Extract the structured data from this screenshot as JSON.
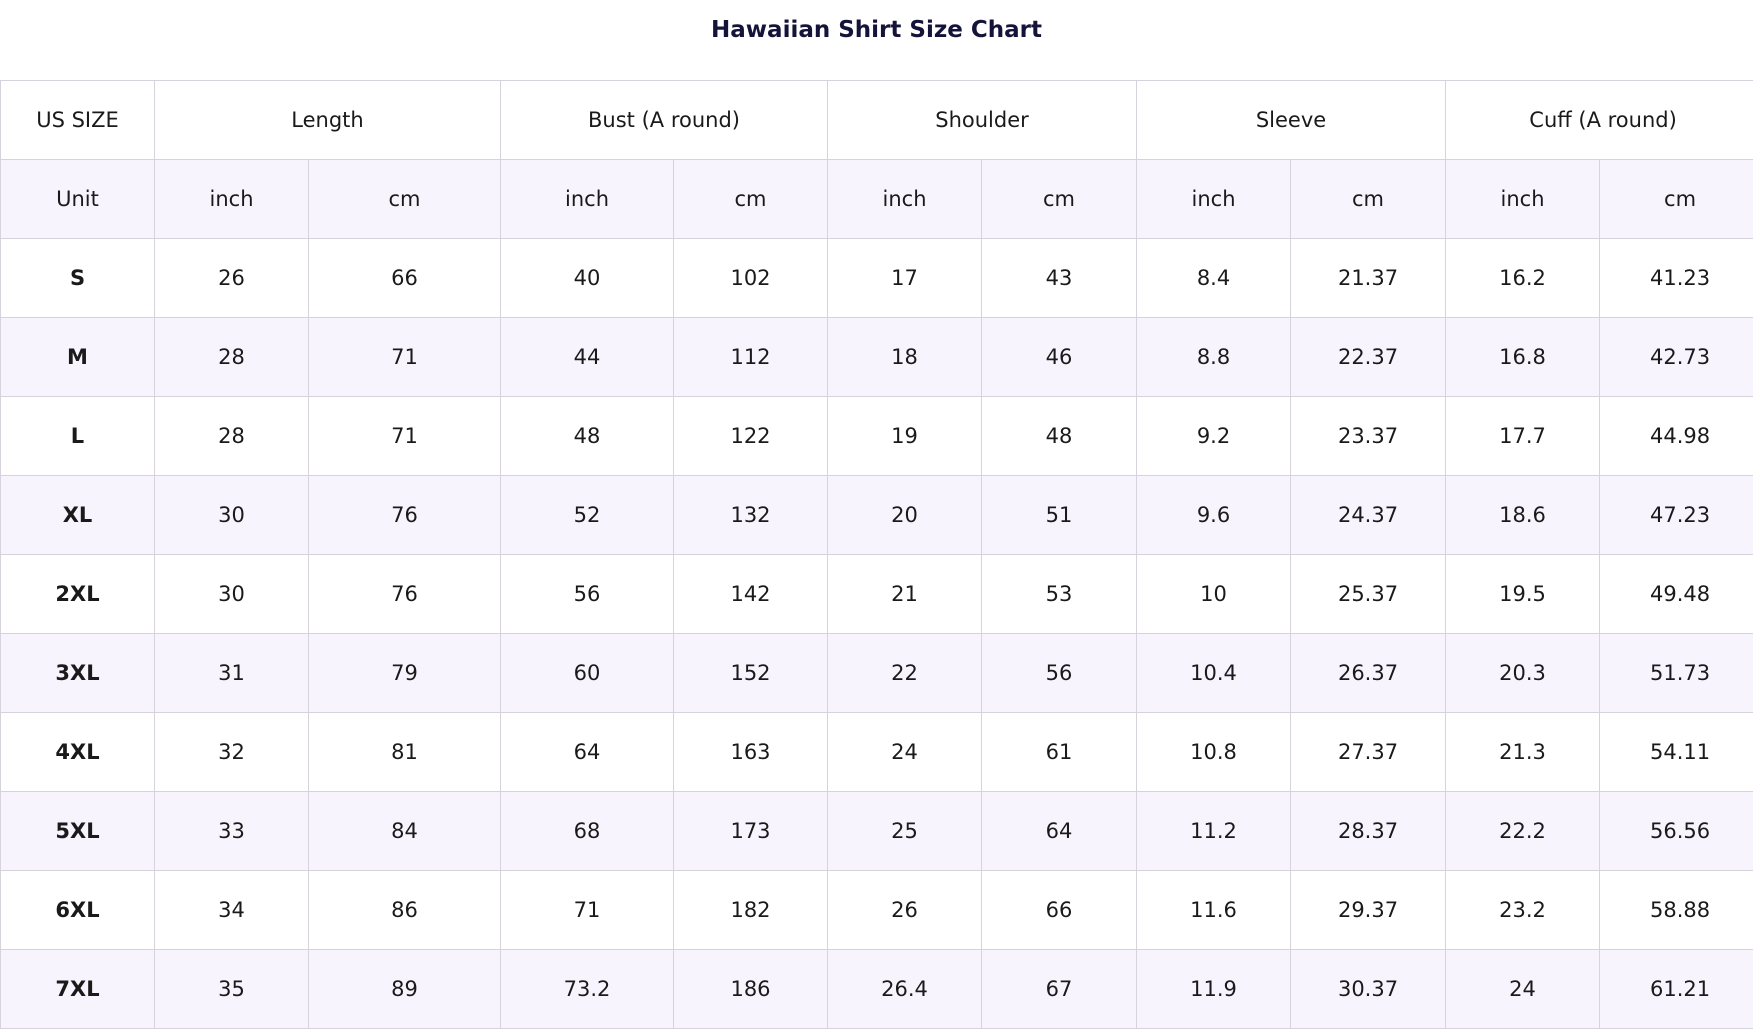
{
  "title": "Hawaiian Shirt Size Chart",
  "header": {
    "first": "US SIZE",
    "groups": [
      "Length",
      "Bust (A round)",
      "Shoulder",
      "Sleeve",
      "Cuff (A round)"
    ]
  },
  "unit_row": {
    "label": "Unit",
    "units": [
      "inch",
      "cm",
      "inch",
      "cm",
      "inch",
      "cm",
      "inch",
      "cm",
      "inch",
      "cm"
    ]
  },
  "rows": [
    {
      "size": "S",
      "values": [
        "26",
        "66",
        "40",
        "102",
        "17",
        "43",
        "8.4",
        "21.37",
        "16.2",
        "41.23"
      ]
    },
    {
      "size": "M",
      "values": [
        "28",
        "71",
        "44",
        "112",
        "18",
        "46",
        "8.8",
        "22.37",
        "16.8",
        "42.73"
      ]
    },
    {
      "size": "L",
      "values": [
        "28",
        "71",
        "48",
        "122",
        "19",
        "48",
        "9.2",
        "23.37",
        "17.7",
        "44.98"
      ]
    },
    {
      "size": "XL",
      "values": [
        "30",
        "76",
        "52",
        "132",
        "20",
        "51",
        "9.6",
        "24.37",
        "18.6",
        "47.23"
      ]
    },
    {
      "size": "2XL",
      "values": [
        "30",
        "76",
        "56",
        "142",
        "21",
        "53",
        "10",
        "25.37",
        "19.5",
        "49.48"
      ]
    },
    {
      "size": "3XL",
      "values": [
        "31",
        "79",
        "60",
        "152",
        "22",
        "56",
        "10.4",
        "26.37",
        "20.3",
        "51.73"
      ]
    },
    {
      "size": "4XL",
      "values": [
        "32",
        "81",
        "64",
        "163",
        "24",
        "61",
        "10.8",
        "27.37",
        "21.3",
        "54.11"
      ]
    },
    {
      "size": "5XL",
      "values": [
        "33",
        "84",
        "68",
        "173",
        "25",
        "64",
        "11.2",
        "28.37",
        "22.2",
        "56.56"
      ]
    },
    {
      "size": "6XL",
      "values": [
        "34",
        "86",
        "71",
        "182",
        "26",
        "66",
        "11.6",
        "29.37",
        "23.2",
        "58.88"
      ]
    },
    {
      "size": "7XL",
      "values": [
        "35",
        "89",
        "73.2",
        "186",
        "26.4",
        "67",
        "11.9",
        "30.37",
        "24",
        "61.21"
      ]
    }
  ],
  "colors": {
    "title": "#14143a",
    "text": "#1a1a1a",
    "border": "#d7d3dc",
    "row_odd": "#ffffff",
    "row_even": "#f8f4fd"
  }
}
